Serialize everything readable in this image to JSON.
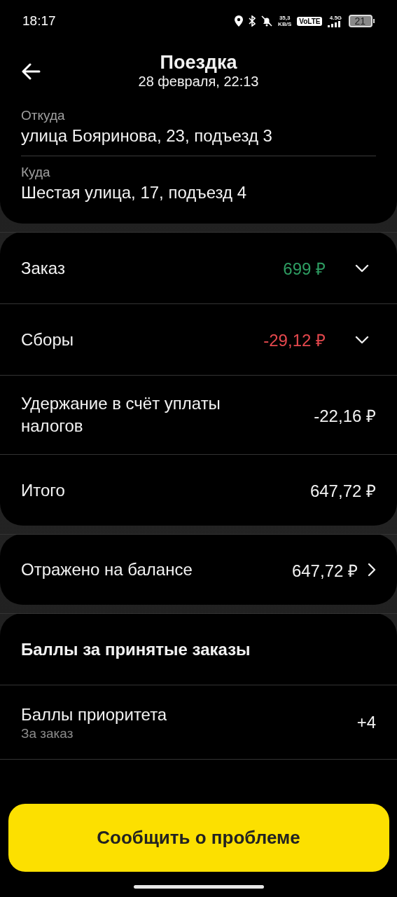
{
  "status_bar": {
    "time": "18:17",
    "speed_value": "35,3",
    "speed_unit": "KB/S",
    "volte": "VoLTE",
    "network": "4.5G",
    "battery": "21"
  },
  "header": {
    "title": "Поездка",
    "subtitle": "28 февраля, 22:13"
  },
  "route": [
    {
      "label": "Откуда",
      "address": "улица Бояринова, 23, подъезд 3"
    },
    {
      "label": "Куда",
      "address": "Шестая улица, 17, подъезд 4"
    }
  ],
  "summary": [
    {
      "label": "Заказ",
      "value": "699 ₽",
      "color": "#2e9d62",
      "expandable": true
    },
    {
      "label": "Сборы",
      "value": "-29,12 ₽",
      "color": "#e5484d",
      "expandable": true
    },
    {
      "label": "Удержание в счёт уплаты налогов",
      "value": "-22,16 ₽",
      "color": "#f2f2f2",
      "expandable": false
    },
    {
      "label": "Итого",
      "value": "647,72 ₽",
      "color": "#f2f2f2",
      "expandable": false
    }
  ],
  "balance": {
    "label": "Отражено на балансе",
    "value": "647,72 ₽",
    "opens_details": true
  },
  "points": {
    "title": "Баллы за принятые заказы",
    "rows": [
      {
        "label": "Баллы приоритета",
        "note": "За заказ",
        "value": "+4"
      }
    ]
  },
  "report_button": {
    "label": "Сообщить о проблеме"
  }
}
